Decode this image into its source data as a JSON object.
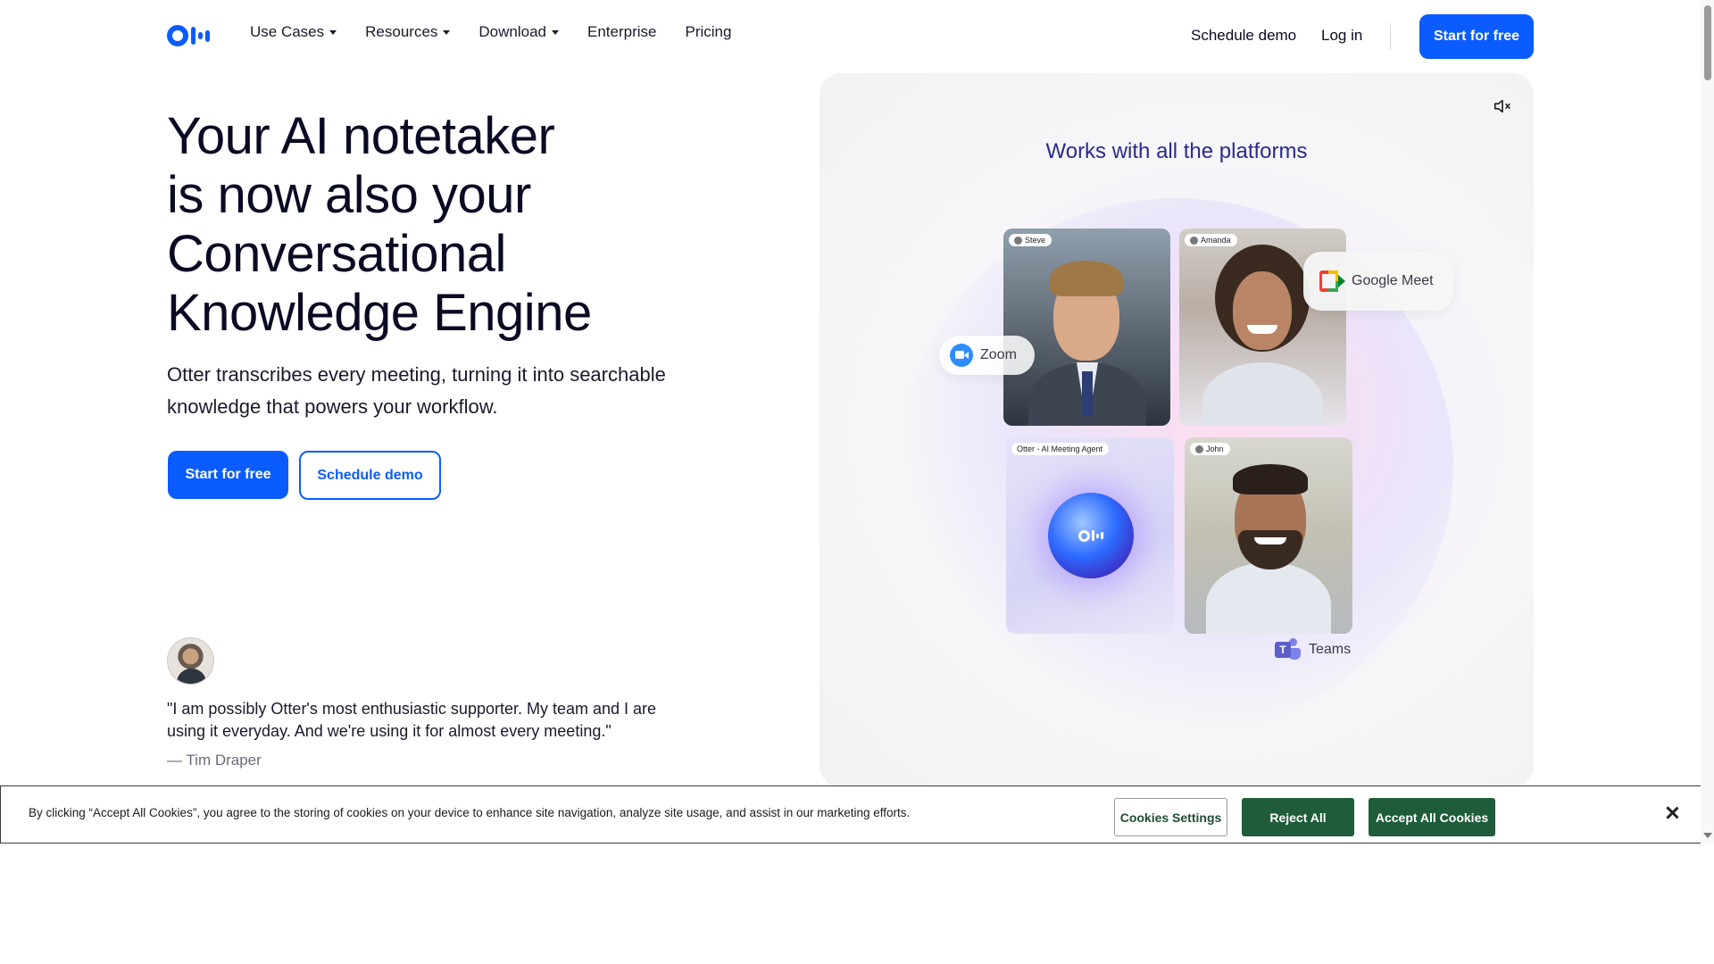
{
  "brand": {
    "logo_icon": "otter-logo-icon",
    "accent": "#0b5cff"
  },
  "nav": {
    "items": [
      {
        "label": "Use Cases",
        "dropdown": true
      },
      {
        "label": "Resources",
        "dropdown": true
      },
      {
        "label": "Download",
        "dropdown": true
      },
      {
        "label": "Enterprise",
        "dropdown": false
      },
      {
        "label": "Pricing",
        "dropdown": false
      }
    ],
    "schedule_demo": "Schedule demo",
    "login": "Log in",
    "cta": "Start for free"
  },
  "hero": {
    "title_lines": [
      "Your AI notetaker",
      "is now also your",
      "Conversational",
      "Knowledge Engine"
    ],
    "subtitle": "Otter transcribes every meeting, turning it into searchable knowledge that powers your workflow.",
    "cta_primary": "Start for free",
    "cta_secondary": "Schedule demo"
  },
  "testimonial": {
    "quote": "\"I am possibly Otter's most enthusiastic supporter. My team and I are using it everyday. And we're using it for almost every meeting.\"",
    "author": "— Tim Draper"
  },
  "video_panel": {
    "title": "Works with all the platforms",
    "mute_icon": "muted-speaker-icon",
    "participants": [
      {
        "name": "Steve"
      },
      {
        "name": "Amanda"
      },
      {
        "name": "Otter - AI Meeting Agent"
      },
      {
        "name": "John"
      }
    ],
    "platforms": {
      "zoom": "Zoom",
      "meet": "Google Meet",
      "teams": "Teams"
    }
  },
  "cookie_banner": {
    "text": "By clicking “Accept All Cookies”, you agree to the storing of cookies on your device to enhance site navigation, analyze site usage, and assist in our marketing efforts.",
    "settings": "Cookies Settings",
    "reject": "Reject All",
    "accept": "Accept All Cookies",
    "button_color": "#1f5c3a"
  }
}
